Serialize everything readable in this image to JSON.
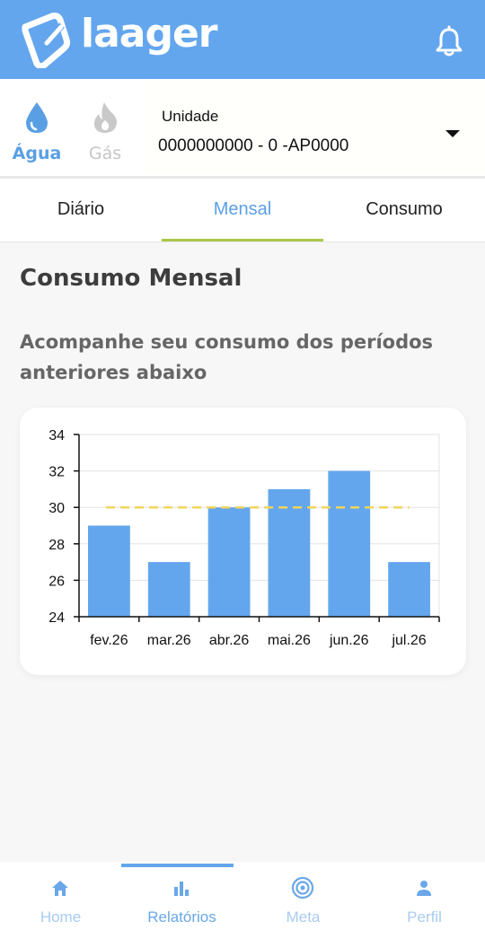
{
  "header": {
    "logo_text": "laager",
    "bell_icon": "bell-icon"
  },
  "utilities": [
    {
      "label": "Água",
      "icon": "water-drop-icon",
      "selected": true
    },
    {
      "label": "Gás",
      "icon": "flame-icon",
      "selected": false
    }
  ],
  "unit": {
    "label": "Unidade",
    "value": "0000000000 - 0 -AP0000"
  },
  "tabs": [
    {
      "label": "Diário"
    },
    {
      "label": "Mensal",
      "active": true
    },
    {
      "label": "Consumo"
    }
  ],
  "section": {
    "title": "Consumo Mensal",
    "subtitle": "Acompanhe seu consumo dos períodos anteriores abaixo"
  },
  "chart_data": {
    "type": "bar",
    "categories": [
      "fev.26",
      "mar.26",
      "abr.26",
      "mai.26",
      "jun.26",
      "jul.26"
    ],
    "values": [
      29,
      27,
      30,
      31,
      32,
      27
    ],
    "ylim": [
      24,
      34
    ],
    "yticks": [
      24,
      26,
      28,
      30,
      32,
      34
    ],
    "reference_line": 30,
    "grid": true,
    "bar_color": "#63a6ee",
    "reference_color": "#f2d55a"
  },
  "bottom_nav": [
    {
      "label": "Home",
      "icon": "home-icon"
    },
    {
      "label": "Relatórios",
      "icon": "bar-chart-icon",
      "active": true
    },
    {
      "label": "Meta",
      "icon": "target-icon"
    },
    {
      "label": "Perfil",
      "icon": "person-icon"
    }
  ],
  "colors": {
    "brand": "#63a6ee",
    "tab_accent": "#a9c94a"
  }
}
